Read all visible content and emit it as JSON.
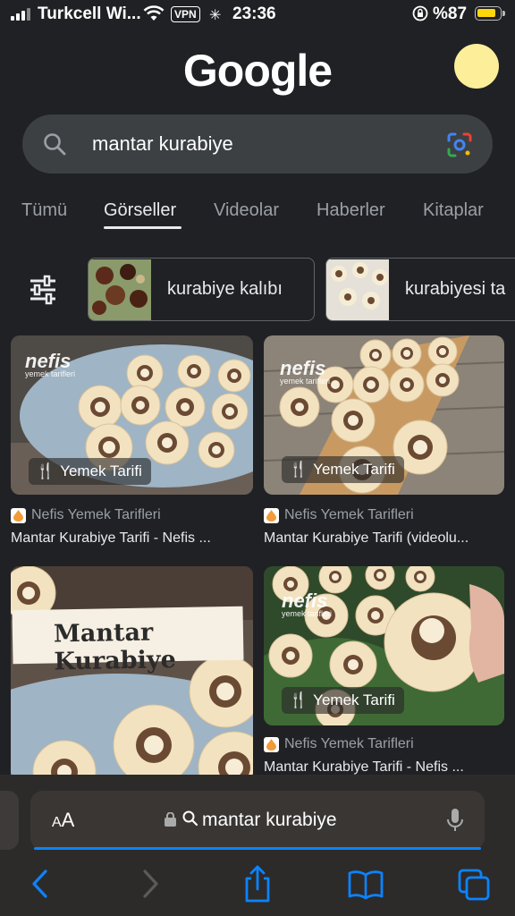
{
  "status_bar": {
    "carrier": "Turkcell Wi...",
    "vpn": "VPN",
    "time": "23:36",
    "battery": "%87",
    "battery_level": 0.87
  },
  "header": {
    "logo": "Google"
  },
  "search": {
    "query": "mantar kurabiye"
  },
  "tabs": [
    {
      "label": "Tümü"
    },
    {
      "label": "Görseller",
      "active": true
    },
    {
      "label": "Videolar"
    },
    {
      "label": "Haberler"
    },
    {
      "label": "Kitaplar"
    }
  ],
  "chips": [
    {
      "label": "kurabiye kalıbı"
    },
    {
      "label": "kurabiyesi ta"
    }
  ],
  "results": [
    {
      "badge": "Yemek Tarifi",
      "source": "Nefis Yemek Tarifleri",
      "title": "Mantar Kurabiye Tarifi - Nefis ...",
      "watermark": "nefis",
      "watermark_sub": "yemek tarifleri"
    },
    {
      "badge": "Yemek Tarifi",
      "source": "Nefis Yemek Tarifleri",
      "title": "Mantar Kurabiye Tarifi (videolu...",
      "watermark": "nefis",
      "watermark_sub": "yemek tarifleri"
    },
    {
      "overlay_text": "Mantar Kurabiye"
    },
    {
      "badge": "Yemek Tarifi",
      "source": "Nefis Yemek Tarifleri",
      "title": "Mantar Kurabiye Tarifi - Nefis ...",
      "watermark": "nefis",
      "watermark_sub": "yemek tarifleri"
    }
  ],
  "browser": {
    "aa": "AA",
    "url": "mantar kurabiye"
  },
  "colors": {
    "background": "#202124",
    "accent_blue": "#0a84ff",
    "avatar": "#fdef9a",
    "battery": "#ffd60a"
  }
}
